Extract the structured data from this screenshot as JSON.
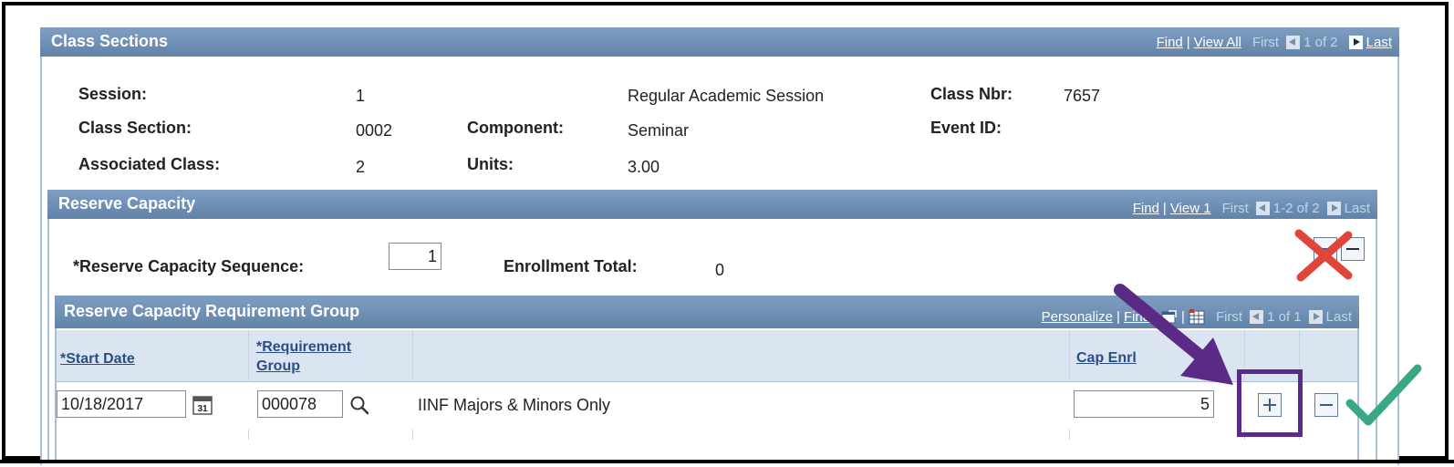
{
  "class_sections": {
    "title": "Class Sections",
    "nav": {
      "find": "Find",
      "sep": "|",
      "view_all": "View All",
      "first": "First",
      "count": "1 of 2",
      "last": "Last"
    },
    "fields": {
      "session_label": "Session:",
      "session_value": "1",
      "session_desc": "Regular Academic Session",
      "class_nbr_label": "Class Nbr:",
      "class_nbr_value": "7657",
      "class_section_label": "Class Section:",
      "class_section_value": "0002",
      "component_label": "Component:",
      "component_value": "Seminar",
      "event_id_label": "Event ID:",
      "associated_class_label": "Associated Class:",
      "associated_class_value": "2",
      "units_label": "Units:",
      "units_value": "3.00"
    }
  },
  "reserve_capacity": {
    "title": "Reserve Capacity",
    "nav": {
      "find": "Find",
      "sep": "|",
      "view": "View 1",
      "first": "First",
      "count": "1-2 of 2",
      "last": "Last"
    },
    "sequence_label": "*Reserve Capacity Sequence:",
    "sequence_value": "1",
    "enrollment_total_label": "Enrollment Total:",
    "enrollment_total_value": "0"
  },
  "requirement_group": {
    "title": "Reserve Capacity Requirement Group",
    "nav": {
      "personalize": "Personalize",
      "sep": "|",
      "find": "Find",
      "first": "First",
      "count": "1 of 1",
      "last": "Last"
    },
    "columns": {
      "start_date": "*Start Date",
      "requirement_group_1": "*Requirement",
      "requirement_group_2": "Group",
      "cap_enrl": "Cap Enrl"
    },
    "row": {
      "start_date": "10/18/2017",
      "requirement_group": "000078",
      "description": "IINF Majors & Minors Only",
      "cap_enrl": "5"
    }
  },
  "colors": {
    "header_bar": "#6f8fb6",
    "arrow": "#5b2a86",
    "highlight_box": "#5b2a86",
    "x_mark": "#e0453a",
    "check_mark": "#3aa884"
  },
  "icons": [
    "calendar-icon",
    "lookup-icon",
    "zoom-window-icon",
    "download-grid-icon",
    "add-row-icon",
    "delete-row-icon",
    "first-arrow-icon",
    "next-arrow-icon"
  ]
}
